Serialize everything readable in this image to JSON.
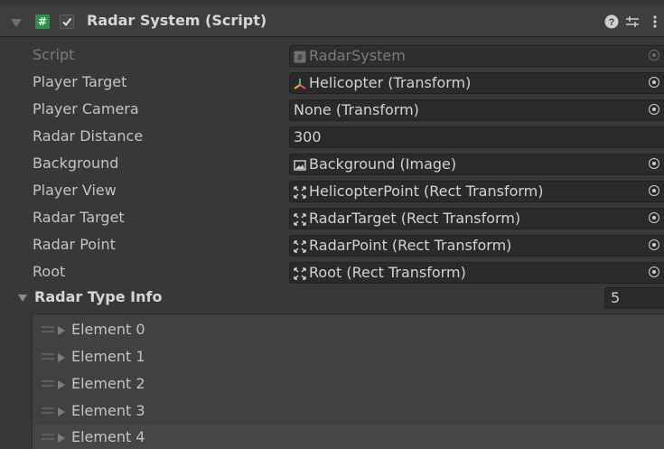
{
  "header": {
    "title": "Radar System (Script)",
    "script_icon_glyph": "#",
    "enabled": true,
    "icons": [
      "help-icon",
      "preset-icon",
      "more-icon"
    ]
  },
  "properties": [
    {
      "label": "Script",
      "value": "RadarSystem",
      "icon": "script-icon",
      "disabled": true
    },
    {
      "label": "Player Target",
      "value": "Helicopter (Transform)",
      "icon": "transform-icon"
    },
    {
      "label": "Player Camera",
      "value": "None (Transform)",
      "icon": ""
    },
    {
      "label": "Radar Distance",
      "value": "300",
      "icon": "",
      "numeric": true
    },
    {
      "label": "Background",
      "value": "Background (Image)",
      "icon": "image-icon"
    },
    {
      "label": "Player View",
      "value": "HelicopterPoint (Rect Transform)",
      "icon": "rect-transform-icon"
    },
    {
      "label": "Radar Target",
      "value": "RadarTarget (Rect Transform)",
      "icon": "rect-transform-icon"
    },
    {
      "label": "Radar Point",
      "value": "RadarPoint (Rect Transform)",
      "icon": "rect-transform-icon"
    },
    {
      "label": "Root",
      "value": "Root (Rect Transform)",
      "icon": "rect-transform-icon"
    }
  ],
  "list": {
    "title": "Radar Type Info",
    "size": "5",
    "elements": [
      "Element 0",
      "Element 1",
      "Element 2",
      "Element 3",
      "Element 4"
    ]
  },
  "colors": {
    "background": "#383838",
    "field": "#2a2a2a",
    "script_badge": "#2f8d4f"
  }
}
